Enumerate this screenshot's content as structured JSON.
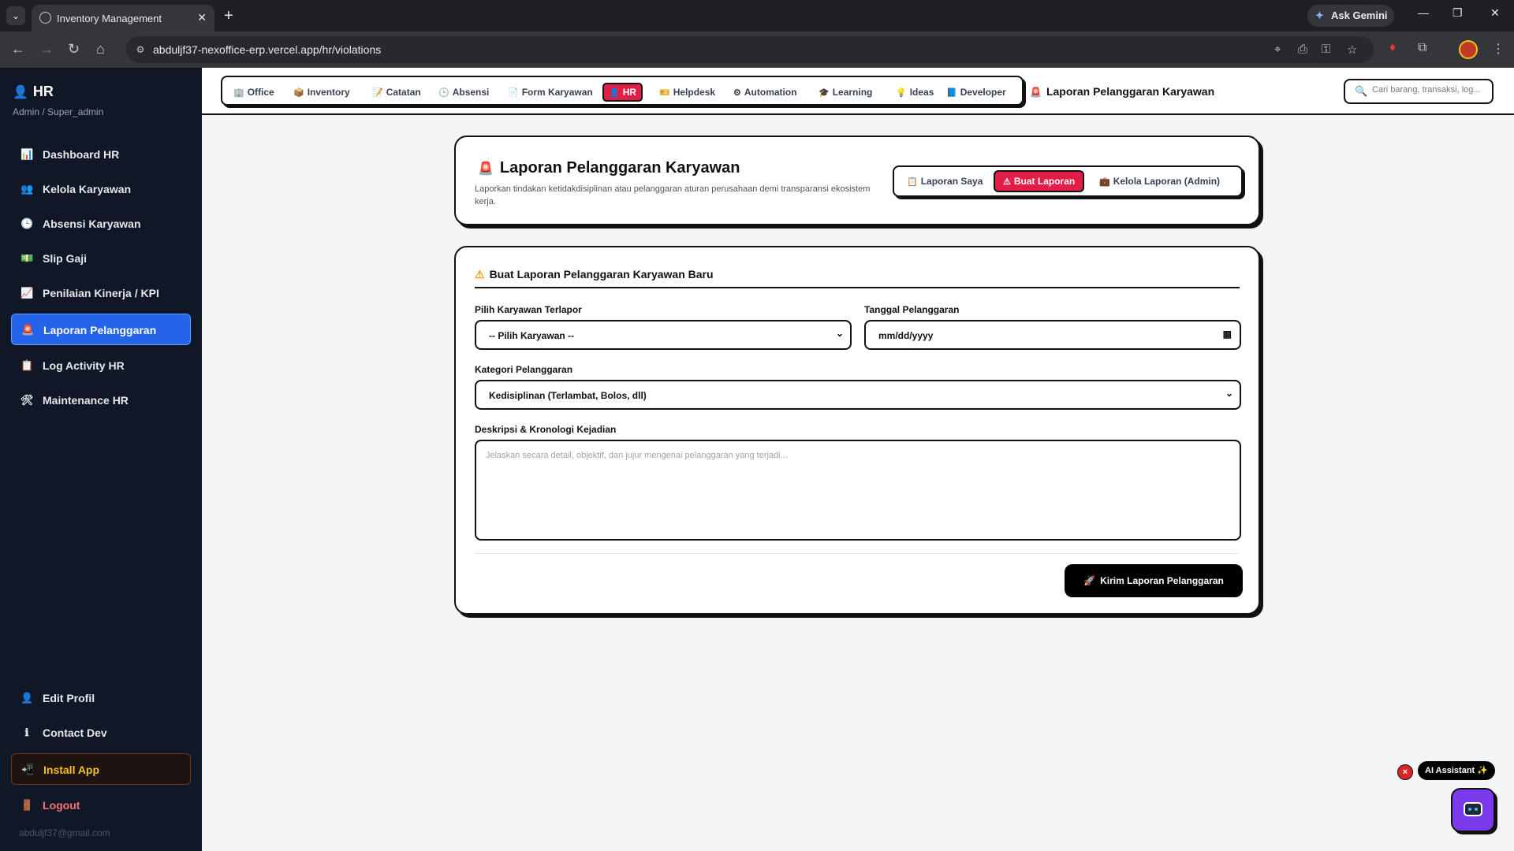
{
  "browser": {
    "tab_title": "Inventory Management",
    "url": "abduljf37-nexoffice-erp.vercel.app/hr/violations",
    "gemini_label": "Ask Gemini"
  },
  "sidebar": {
    "title": "HR",
    "subtitle": "Admin / Super_admin",
    "items": [
      {
        "label": "Dashboard HR",
        "icon": "chart-icon"
      },
      {
        "label": "Kelola Karyawan",
        "icon": "people-icon"
      },
      {
        "label": "Absensi Karyawan",
        "icon": "clock-icon"
      },
      {
        "label": "Slip Gaji",
        "icon": "money-icon"
      },
      {
        "label": "Penilaian Kinerja / KPI",
        "icon": "trend-icon"
      },
      {
        "label": "Laporan Pelanggaran",
        "icon": "siren-icon"
      },
      {
        "label": "Log Activity HR",
        "icon": "clipboard-icon"
      },
      {
        "label": "Maintenance HR",
        "icon": "tools-icon"
      }
    ],
    "bottom_items": [
      {
        "label": "Edit Profil",
        "icon": "user-icon"
      },
      {
        "label": "Contact Dev",
        "icon": "info-icon"
      },
      {
        "label": "Install App",
        "icon": "install-icon"
      },
      {
        "label": "Logout",
        "icon": "door-icon"
      }
    ],
    "email": "abduljf37@gmail.com"
  },
  "topnav": {
    "links": [
      {
        "label": "Office"
      },
      {
        "label": "Inventory"
      },
      {
        "label": "Catatan"
      },
      {
        "label": "Absensi"
      },
      {
        "label": "Form Karyawan"
      },
      {
        "label": "HR"
      },
      {
        "label": "Helpdesk"
      },
      {
        "label": "Automation"
      },
      {
        "label": "Learning"
      },
      {
        "label": "Ideas"
      },
      {
        "label": "Developer"
      }
    ],
    "breadcrumb": "Laporan Pelanggaran Karyawan",
    "search_placeholder": "Cari barang, transaksi, log..."
  },
  "header_card": {
    "title": "Laporan Pelanggaran Karyawan",
    "description": "Laporkan tindakan ketidakdisiplinan atau pelanggaran aturan perusahaan demi transparansi ekosistem kerja.",
    "tabs": [
      {
        "label": "Laporan Saya"
      },
      {
        "label": "Buat Laporan"
      },
      {
        "label": "Kelola Laporan (Admin)"
      }
    ]
  },
  "form": {
    "title": "Buat Laporan Pelanggaran Karyawan Baru",
    "employee_label": "Pilih Karyawan Terlapor",
    "employee_value": "-- Pilih Karyawan --",
    "date_label": "Tanggal Pelanggaran",
    "date_value": "mm/dd/yyyy",
    "category_label": "Kategori Pelanggaran",
    "category_value": "Kedisiplinan (Terlambat, Bolos, dll)",
    "description_label": "Deskripsi & Kronologi Kejadian",
    "description_placeholder": "Jelaskan secara detail, objektif, dan jujur mengenai pelanggaran yang terjadi...",
    "submit_label": "Kirim Laporan Pelanggaran"
  },
  "assistant": {
    "label": "AI Assistant ✨"
  },
  "colors": {
    "accent_red": "#e11d48",
    "sidebar_bg": "#101827",
    "sidebar_active": "#2563eb"
  }
}
